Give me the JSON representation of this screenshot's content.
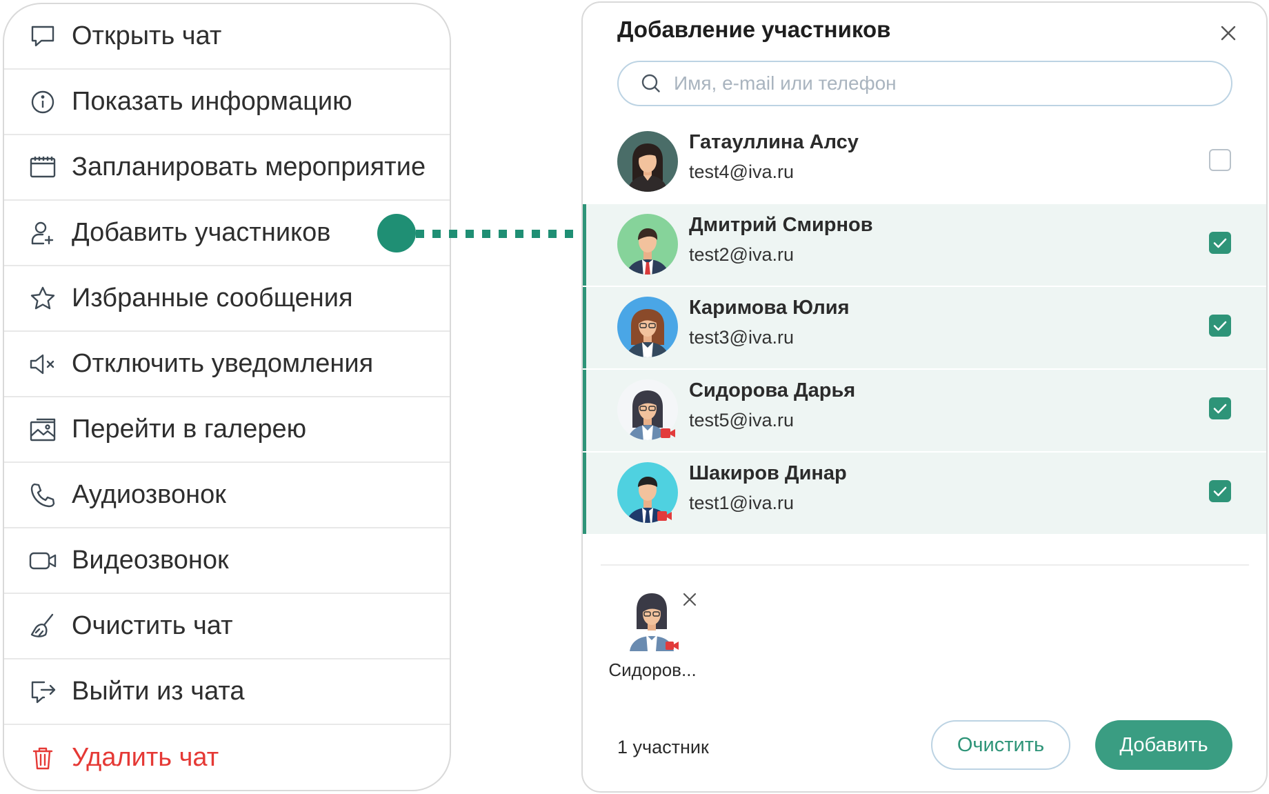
{
  "menu": {
    "items": [
      {
        "label": "Открыть чат",
        "icon": "chat-bubble-icon",
        "danger": false
      },
      {
        "label": "Показать информацию",
        "icon": "info-icon",
        "danger": false
      },
      {
        "label": "Запланировать мероприятие",
        "icon": "calendar-icon",
        "danger": false
      },
      {
        "label": "Добавить участников",
        "icon": "add-user-icon",
        "danger": false
      },
      {
        "label": "Избранные сообщения",
        "icon": "star-icon",
        "danger": false
      },
      {
        "label": "Отключить уведомления",
        "icon": "mute-icon",
        "danger": false
      },
      {
        "label": "Перейти в галерею",
        "icon": "gallery-icon",
        "danger": false
      },
      {
        "label": "Аудиозвонок",
        "icon": "phone-icon",
        "danger": false
      },
      {
        "label": "Видеозвонок",
        "icon": "video-icon",
        "danger": false
      },
      {
        "label": "Очистить чат",
        "icon": "broom-icon",
        "danger": false
      },
      {
        "label": "Выйти из чата",
        "icon": "exit-icon",
        "danger": false
      },
      {
        "label": "Удалить чат",
        "icon": "trash-icon",
        "danger": true
      }
    ]
  },
  "dialog": {
    "title": "Добавление участников",
    "search_placeholder": "Имя, e-mail или телефон",
    "contacts": [
      {
        "name": "Гатауллина Алсу",
        "email": "test4@iva.ru",
        "selected": false,
        "avatar": "woman-dark-hair"
      },
      {
        "name": "Дмитрий Смирнов",
        "email": "test2@iva.ru",
        "selected": true,
        "avatar": "man-suit-red-tie"
      },
      {
        "name": "Каримова Юлия",
        "email": "test3@iva.ru",
        "selected": true,
        "avatar": "woman-glasses-blue"
      },
      {
        "name": "Сидорова Дарья",
        "email": "test5@iva.ru",
        "selected": true,
        "avatar": "woman-glasses-video"
      },
      {
        "name": "Шакиров Динар",
        "email": "test1@iva.ru",
        "selected": true,
        "avatar": "man-teal-video"
      }
    ],
    "chip": {
      "name": "Сидоров..."
    },
    "count_label": "1 участник",
    "clear_label": "Очистить",
    "add_label": "Добавить"
  },
  "colors": {
    "accent": "#2e9478",
    "add_button": "#3a9d82",
    "danger": "#e53935",
    "selected_row": "#eef5f3",
    "search_border": "#bcd3e3"
  }
}
